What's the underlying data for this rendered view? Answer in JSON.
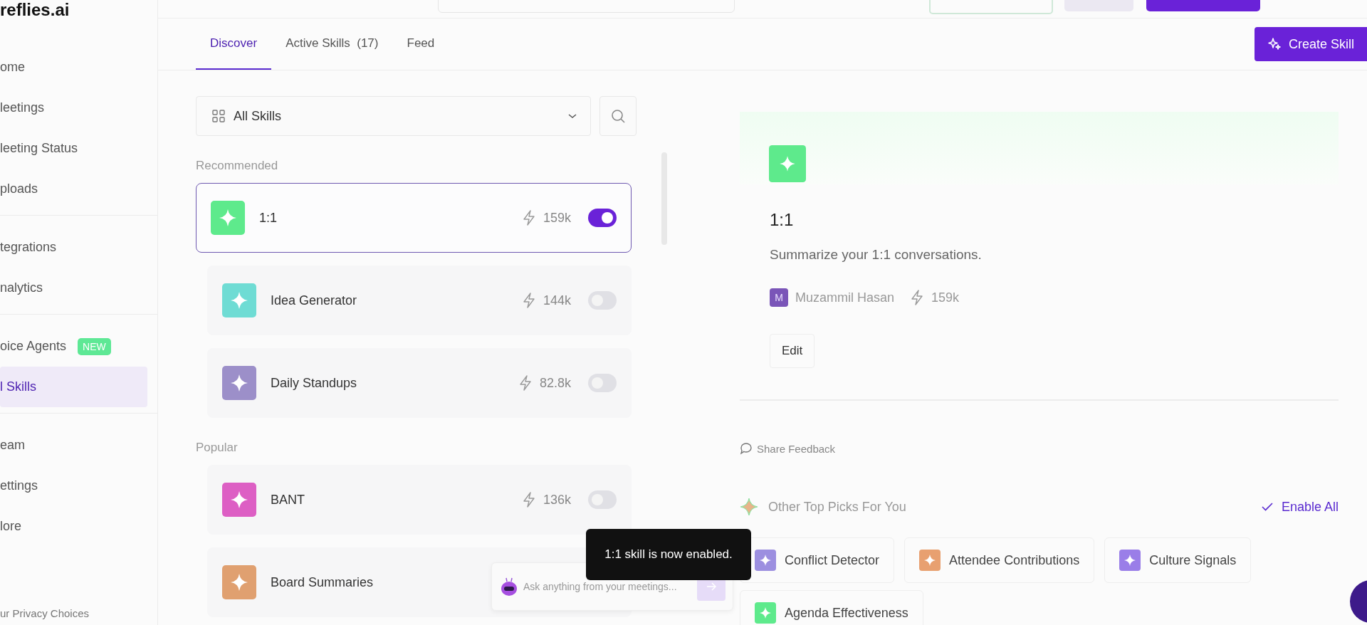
{
  "logo": "reflies.ai",
  "sidebar": {
    "groups": [
      {
        "items": [
          {
            "label": "ome",
            "selected": false
          },
          {
            "label": "leetings",
            "selected": false
          },
          {
            "label": "leeting Status",
            "selected": false
          },
          {
            "label": "ploads",
            "selected": false
          }
        ]
      },
      {
        "items": [
          {
            "label": "tegrations",
            "selected": false
          },
          {
            "label": "nalytics",
            "selected": false
          }
        ]
      },
      {
        "items": [
          {
            "label": "oice Agents",
            "selected": false,
            "badge": "NEW"
          },
          {
            "label": "l Skills",
            "selected": true
          }
        ]
      },
      {
        "items": [
          {
            "label": "eam",
            "selected": false
          },
          {
            "label": "ettings",
            "selected": false
          },
          {
            "label": "lore",
            "selected": false
          }
        ]
      }
    ],
    "footer": "ur Privacy Choices"
  },
  "tabs": [
    {
      "label": "Discover",
      "selected": true
    },
    {
      "label": "Active Skills",
      "count": "(17)",
      "selected": false
    },
    {
      "label": "Feed",
      "selected": false
    }
  ],
  "create_button": "Create Skill",
  "filter": {
    "value": "All Skills"
  },
  "sections": [
    {
      "title": "Recommended",
      "skills": [
        {
          "name": "1:1",
          "uses": "159k",
          "on": true,
          "selected": true,
          "color": "#5eea8c"
        },
        {
          "name": "Idea Generator",
          "uses": "144k",
          "on": false,
          "selected": false,
          "color": "#6fdcd4"
        },
        {
          "name": "Daily Standups",
          "uses": "82.8k",
          "on": false,
          "selected": false,
          "color": "#9c8fc9"
        }
      ]
    },
    {
      "title": "Popular",
      "skills": [
        {
          "name": "BANT",
          "uses": "136k",
          "on": false,
          "selected": false,
          "color": "#dd5fc4"
        },
        {
          "name": "Board Summaries",
          "selected": false,
          "color": "#e0a070"
        }
      ]
    }
  ],
  "detail": {
    "title": "1:1",
    "description": "Summarize your 1:1 conversations.",
    "author_initial": "M",
    "author": "Muzammil Hasan",
    "uses": "159k",
    "edit_button": "Edit"
  },
  "feedback_link": "Share Feedback",
  "top_picks": {
    "title": "Other Top Picks For You",
    "enable_all": "Enable All",
    "items": [
      {
        "name": "Conflict Detector",
        "color": "#9c8fe0"
      },
      {
        "name": "Attendee Contributions",
        "color": "#e8a070"
      },
      {
        "name": "Culture Signals",
        "color": "#9a7ee8"
      },
      {
        "name": "Agenda Effectiveness",
        "color": "#5eea8c"
      }
    ]
  },
  "ask_bar": {
    "placeholder": "Ask anything from your meetings..."
  },
  "toast": "1:1 skill is now enabled."
}
